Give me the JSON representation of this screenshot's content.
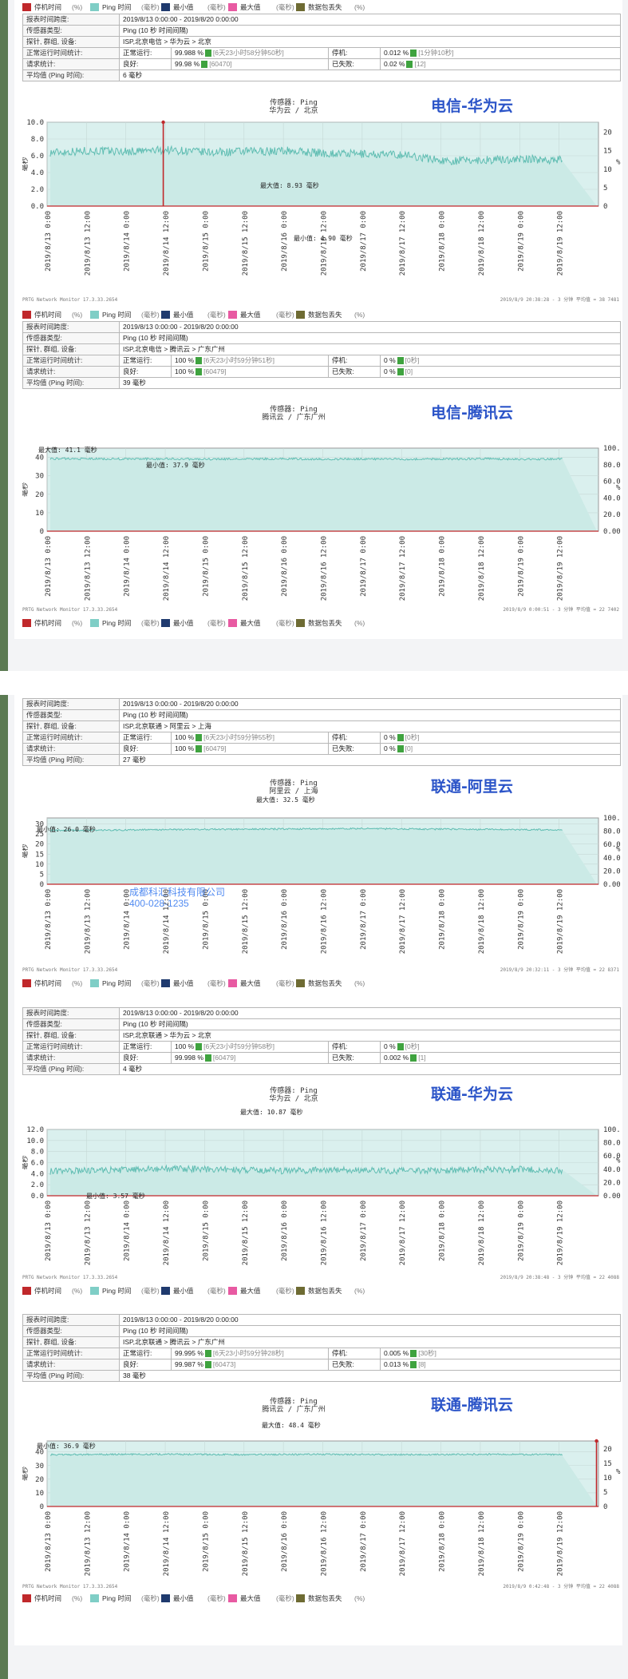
{
  "legend": {
    "items": [
      {
        "label": "停机时间",
        "color": "#c0282b"
      },
      {
        "label": "(%)",
        "unit": true
      },
      {
        "label": "Ping 时间",
        "color": "#7fcec6"
      },
      {
        "label": "(毫秒)",
        "unit": true
      },
      {
        "label": "最小值",
        "color": "#1f3a6e"
      },
      {
        "label": "(毫秒)",
        "unit": true
      },
      {
        "label": "最大值",
        "color": "#e85aa2"
      },
      {
        "label": "(毫秒)",
        "unit": true
      },
      {
        "label": "数据包丢失",
        "color": "#6e6b33"
      },
      {
        "label": "(%)",
        "unit": true
      }
    ]
  },
  "labels": {
    "period": "报表时间跨度:",
    "sensor_type": "传感器类型:",
    "probe": "探针, 群组, 设备:",
    "uptime_stats": "正常运行时间统计:",
    "request_stats": "请求统计:",
    "avg_ping": "平均值 (Ping 时间):",
    "uptime": "正常运行:",
    "good": "良好:",
    "down": "停机:",
    "failed": "已失败:"
  },
  "watermark": {
    "line1": "成都科汇科技有限公司",
    "line2": "400-028-1235"
  },
  "reports": [
    {
      "period": "2019/8/13 0:00:00 - 2019/8/20 0:00:00",
      "sensor_type": "Ping (10 秒 时间间隔)",
      "probe": "ISP,北京电信 > 华为云 > 北京",
      "uptime_pct": "99.988 %",
      "uptime_dur": "[6天23小时58分钟50秒]",
      "down_pct": "0.012 %",
      "down_dur": "[1分钟10秒]",
      "good_pct": "99.98 %",
      "good_cnt": "[60470]",
      "failed_pct": "0.02 %",
      "failed_cnt": "[12]",
      "avg": "6 毫秒"
    },
    {
      "period": "2019/8/13 0:00:00 - 2019/8/20 0:00:00",
      "sensor_type": "Ping (10 秒 时间间隔)",
      "probe": "ISP,北京电信 > 腾讯云 > 广东广州",
      "uptime_pct": "100 %",
      "uptime_dur": "[6天23小时59分钟51秒]",
      "down_pct": "0 %",
      "down_dur": "[0秒]",
      "good_pct": "100 %",
      "good_cnt": "[60479]",
      "failed_pct": "0 %",
      "failed_cnt": "[0]",
      "avg": "39 毫秒"
    },
    {
      "period": "2019/8/13 0:00:00 - 2019/8/20 0:00:00",
      "sensor_type": "Ping (10 秒 时间间隔)",
      "probe": "ISP,北京联通 > 阿里云 > 上海",
      "uptime_pct": "100 %",
      "uptime_dur": "[6天23小时59分钟55秒]",
      "down_pct": "0 %",
      "down_dur": "[0秒]",
      "good_pct": "100 %",
      "good_cnt": "[60479]",
      "failed_pct": "0 %",
      "failed_cnt": "[0]",
      "avg": "27 毫秒"
    },
    {
      "period": "2019/8/13 0:00:00 - 2019/8/20 0:00:00",
      "sensor_type": "Ping (10 秒 时间间隔)",
      "probe": "ISP,北京联通 > 华为云 > 北京",
      "uptime_pct": "100 %",
      "uptime_dur": "[6天23小时59分钟58秒]",
      "down_pct": "0 %",
      "down_dur": "[0秒]",
      "good_pct": "99.998 %",
      "good_cnt": "[60479]",
      "failed_pct": "0.002 %",
      "failed_cnt": "[1]",
      "avg": "4 毫秒"
    },
    {
      "period": "2019/8/13 0:00:00 - 2019/8/20 0:00:00",
      "sensor_type": "Ping (10 秒 时间间隔)",
      "probe": "ISP,北京联通 > 腾讯云 > 广东广州",
      "uptime_pct": "99.995 %",
      "uptime_dur": "[6天23小时59分钟28秒]",
      "down_pct": "0.005 %",
      "down_dur": "[30秒]",
      "good_pct": "99.987 %",
      "good_cnt": "[60473]",
      "failed_pct": "0.013 %",
      "failed_cnt": "[8]",
      "avg": "38 毫秒"
    }
  ],
  "chart_data": [
    {
      "type": "line",
      "tag": "电信-华为云",
      "sensor": "传感器: Ping",
      "path": "华为云 / 北京",
      "ylabel": "毫秒",
      "ylim": [
        0,
        10
      ],
      "yticks": [
        "0.0",
        "2.0",
        "4.0",
        "6.0",
        "8.0",
        "10.0"
      ],
      "right_ticks": [
        "0",
        "5",
        "10",
        "15",
        "20"
      ],
      "right_unit": "%",
      "x": [
        "2019/8/13 0:00",
        "2019/8/13 12:00",
        "2019/8/14 0:00",
        "2019/8/14 12:00",
        "2019/8/15 0:00",
        "2019/8/15 12:00",
        "2019/8/16 0:00",
        "2019/8/16 12:00",
        "2019/8/17 0:00",
        "2019/8/17 12:00",
        "2019/8/18 0:00",
        "2019/8/18 12:00",
        "2019/8/19 0:00",
        "2019/8/19 12:00"
      ],
      "series": [
        {
          "name": "Ping 时间",
          "values": [
            6.4,
            6.6,
            6.5,
            6.7,
            6.4,
            6.5,
            6.6,
            6.3,
            6.2,
            6.1,
            5.4,
            5.5,
            5.6,
            5.5
          ]
        }
      ],
      "spikes": [
        {
          "x": 2.95,
          "y": 10.0
        }
      ],
      "max_label": "最大值: 8.93 毫秒",
      "min_label": "最小值: 4.90 毫秒",
      "footer_left": "PRTG Network Monitor 17.3.33.2654",
      "footer_right": "2019/8/9 20:38:28 - 3 分钟 平均值 = 38 7481"
    },
    {
      "type": "line",
      "tag": "电信-腾讯云",
      "sensor": "传感器: Ping",
      "path": "腾讯云 / 广东广州",
      "ylabel": "毫秒",
      "ylim": [
        0,
        45
      ],
      "yticks": [
        "0",
        "10",
        "20",
        "30",
        "40"
      ],
      "right_ticks": [
        "0.00",
        "20.00",
        "40.00",
        "60.00",
        "80.00",
        "100.00"
      ],
      "right_unit": "%",
      "x": [
        "2019/8/13 0:00",
        "2019/8/13 12:00",
        "2019/8/14 0:00",
        "2019/8/14 12:00",
        "2019/8/15 0:00",
        "2019/8/15 12:00",
        "2019/8/16 0:00",
        "2019/8/16 12:00",
        "2019/8/17 0:00",
        "2019/8/17 12:00",
        "2019/8/18 0:00",
        "2019/8/18 12:00",
        "2019/8/19 0:00",
        "2019/8/19 12:00"
      ],
      "series": [
        {
          "name": "Ping 时间",
          "values": [
            39.3,
            39.2,
            39.1,
            39.2,
            39.0,
            39.1,
            39.2,
            39.0,
            39.1,
            39.0,
            39.1,
            39.2,
            39.0,
            39.1
          ]
        }
      ],
      "spikes": [],
      "max_label": "最大值: 41.1 毫秒",
      "min_label": "最小值: 37.9 毫秒",
      "footer_left": "PRTG Network Monitor 17.3.33.2654",
      "footer_right": "2019/8/9 0:00:51 - 3 分钟 平均值 = 22 7402"
    },
    {
      "type": "line",
      "tag": "联通-阿里云",
      "sensor": "传感器: Ping",
      "path": "阿里云 / 上海",
      "ylabel": "毫秒",
      "ylim": [
        0,
        33
      ],
      "yticks": [
        "0",
        "5",
        "10",
        "15",
        "20",
        "25",
        "30"
      ],
      "right_ticks": [
        "0.00",
        "20.00",
        "40.00",
        "60.00",
        "80.00",
        "100.00"
      ],
      "right_unit": "%",
      "x": [
        "2019/8/13 0:00",
        "2019/8/13 12:00",
        "2019/8/14 0:00",
        "2019/8/14 12:00",
        "2019/8/15 0:00",
        "2019/8/15 12:00",
        "2019/8/16 0:00",
        "2019/8/16 12:00",
        "2019/8/17 0:00",
        "2019/8/17 12:00",
        "2019/8/18 0:00",
        "2019/8/18 12:00",
        "2019/8/19 0:00",
        "2019/8/19 12:00"
      ],
      "series": [
        {
          "name": "Ping 时间",
          "values": [
            26.8,
            26.9,
            27.0,
            27.2,
            27.3,
            27.4,
            27.5,
            27.6,
            27.7,
            27.5,
            27.4,
            27.3,
            27.2,
            27.1
          ]
        }
      ],
      "spikes": [],
      "max_label": "最大值: 32.5 毫秒",
      "min_label": "最小值: 26.0 毫秒",
      "footer_left": "PRTG Network Monitor 17.3.33.2654",
      "footer_right": "2019/8/9 20:32:11 - 3 分钟 平均值 = 22 8371"
    },
    {
      "type": "line",
      "tag": "联通-华为云",
      "sensor": "传感器: Ping",
      "path": "华为云 / 北京",
      "ylabel": "毫秒",
      "ylim": [
        0,
        12
      ],
      "yticks": [
        "0.0",
        "2.0",
        "4.0",
        "6.0",
        "8.0",
        "10.0",
        "12.0"
      ],
      "right_ticks": [
        "0.00",
        "20.00",
        "40.00",
        "60.00",
        "80.00",
        "100.00"
      ],
      "right_unit": "%",
      "x": [
        "2019/8/13 0:00",
        "2019/8/13 12:00",
        "2019/8/14 0:00",
        "2019/8/14 12:00",
        "2019/8/15 0:00",
        "2019/8/15 12:00",
        "2019/8/16 0:00",
        "2019/8/16 12:00",
        "2019/8/17 0:00",
        "2019/8/17 12:00",
        "2019/8/18 0:00",
        "2019/8/18 12:00",
        "2019/8/19 0:00",
        "2019/8/19 12:00"
      ],
      "series": [
        {
          "name": "Ping 时间",
          "values": [
            4.4,
            4.6,
            4.7,
            4.9,
            4.8,
            4.6,
            4.5,
            4.7,
            4.6,
            4.5,
            4.6,
            4.7,
            4.8,
            4.6
          ]
        }
      ],
      "spikes": [],
      "max_label": "最大值: 10.87 毫秒",
      "min_label": "最小值: 3.57 毫秒",
      "footer_left": "PRTG Network Monitor 17.3.33.2654",
      "footer_right": "2019/8/9 20:38:48 - 3 分钟 平均值 = 22 4088"
    },
    {
      "type": "line",
      "tag": "联通-腾讯云",
      "sensor": "传感器: Ping",
      "path": "腾讯云 / 广东广州",
      "ylabel": "毫秒",
      "ylim": [
        0,
        48
      ],
      "yticks": [
        "0",
        "10",
        "20",
        "30",
        "40"
      ],
      "right_ticks": [
        "0",
        "5",
        "10",
        "15",
        "20"
      ],
      "right_unit": "%",
      "x": [
        "2019/8/13 0:00",
        "2019/8/13 12:00",
        "2019/8/14 0:00",
        "2019/8/14 12:00",
        "2019/8/15 0:00",
        "2019/8/15 12:00",
        "2019/8/16 0:00",
        "2019/8/16 12:00",
        "2019/8/17 0:00",
        "2019/8/17 12:00",
        "2019/8/18 0:00",
        "2019/8/18 12:00",
        "2019/8/19 0:00",
        "2019/8/19 12:00"
      ],
      "series": [
        {
          "name": "Ping 时间",
          "values": [
            38.0,
            38.1,
            38.2,
            38.3,
            38.1,
            38.0,
            38.1,
            38.2,
            38.1,
            38.0,
            38.1,
            38.2,
            38.1,
            38.0
          ]
        }
      ],
      "spikes": [
        {
          "x": 13.95,
          "y": 48.0
        }
      ],
      "max_label": "最大值: 48.4 毫秒",
      "min_label": "最小值: 36.9 毫秒",
      "footer_left": "PRTG Network Monitor 17.3.33.2654",
      "footer_right": "2019/8/9 0:42:48 - 3 分钟 平均值 = 22 4088"
    }
  ]
}
